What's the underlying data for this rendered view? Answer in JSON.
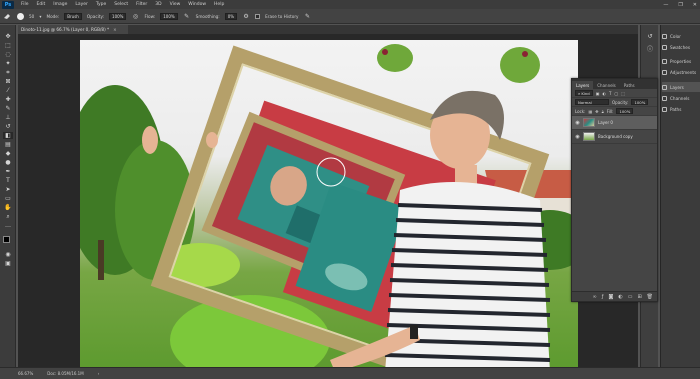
{
  "app": {
    "logo": "Ps"
  },
  "menu": [
    "File",
    "Edit",
    "Image",
    "Layer",
    "Type",
    "Select",
    "Filter",
    "3D",
    "View",
    "Window",
    "Help"
  ],
  "window_controls": [
    "—",
    "❐",
    "✕"
  ],
  "options": {
    "brush_size": "50",
    "mode_label": "Mode:",
    "mode_value": "Brush",
    "opacity_label": "Opacity:",
    "opacity_value": "100%",
    "flow_label": "Flow:",
    "flow_value": "100%",
    "smoothing_label": "Smoothing:",
    "smoothing_value": "0%",
    "erase_history_label": "Erase to History"
  },
  "document_tab": {
    "title": "Dinoto-11.jpg @ 66.7% (Layer 0, RGB/8) *",
    "close": "×"
  },
  "status": {
    "zoom": "66.67%",
    "doc": "Doc: 8.05M/16.1M"
  },
  "dock": {
    "items": [
      "Color",
      "Swatches",
      "Properties",
      "Adjustments",
      "Layers",
      "Channels",
      "Paths"
    ],
    "active": "Layers"
  },
  "layers_panel": {
    "tabs": [
      "Layers",
      "Channels",
      "Paths"
    ],
    "kind_label": "Kind",
    "blend_mode": "Normal",
    "opacity_label": "Opacity:",
    "opacity_value": "100%",
    "lock_label": "Lock:",
    "fill_label": "Fill:",
    "fill_value": "100%",
    "layers": [
      {
        "name": "Layer 0",
        "selected": true
      },
      {
        "name": "Background copy",
        "selected": false
      }
    ]
  },
  "colors": {
    "foreground": "#000000",
    "background": "#ffffff",
    "frame_red": "#c83c44",
    "frame_gold": "#b5a06a"
  }
}
